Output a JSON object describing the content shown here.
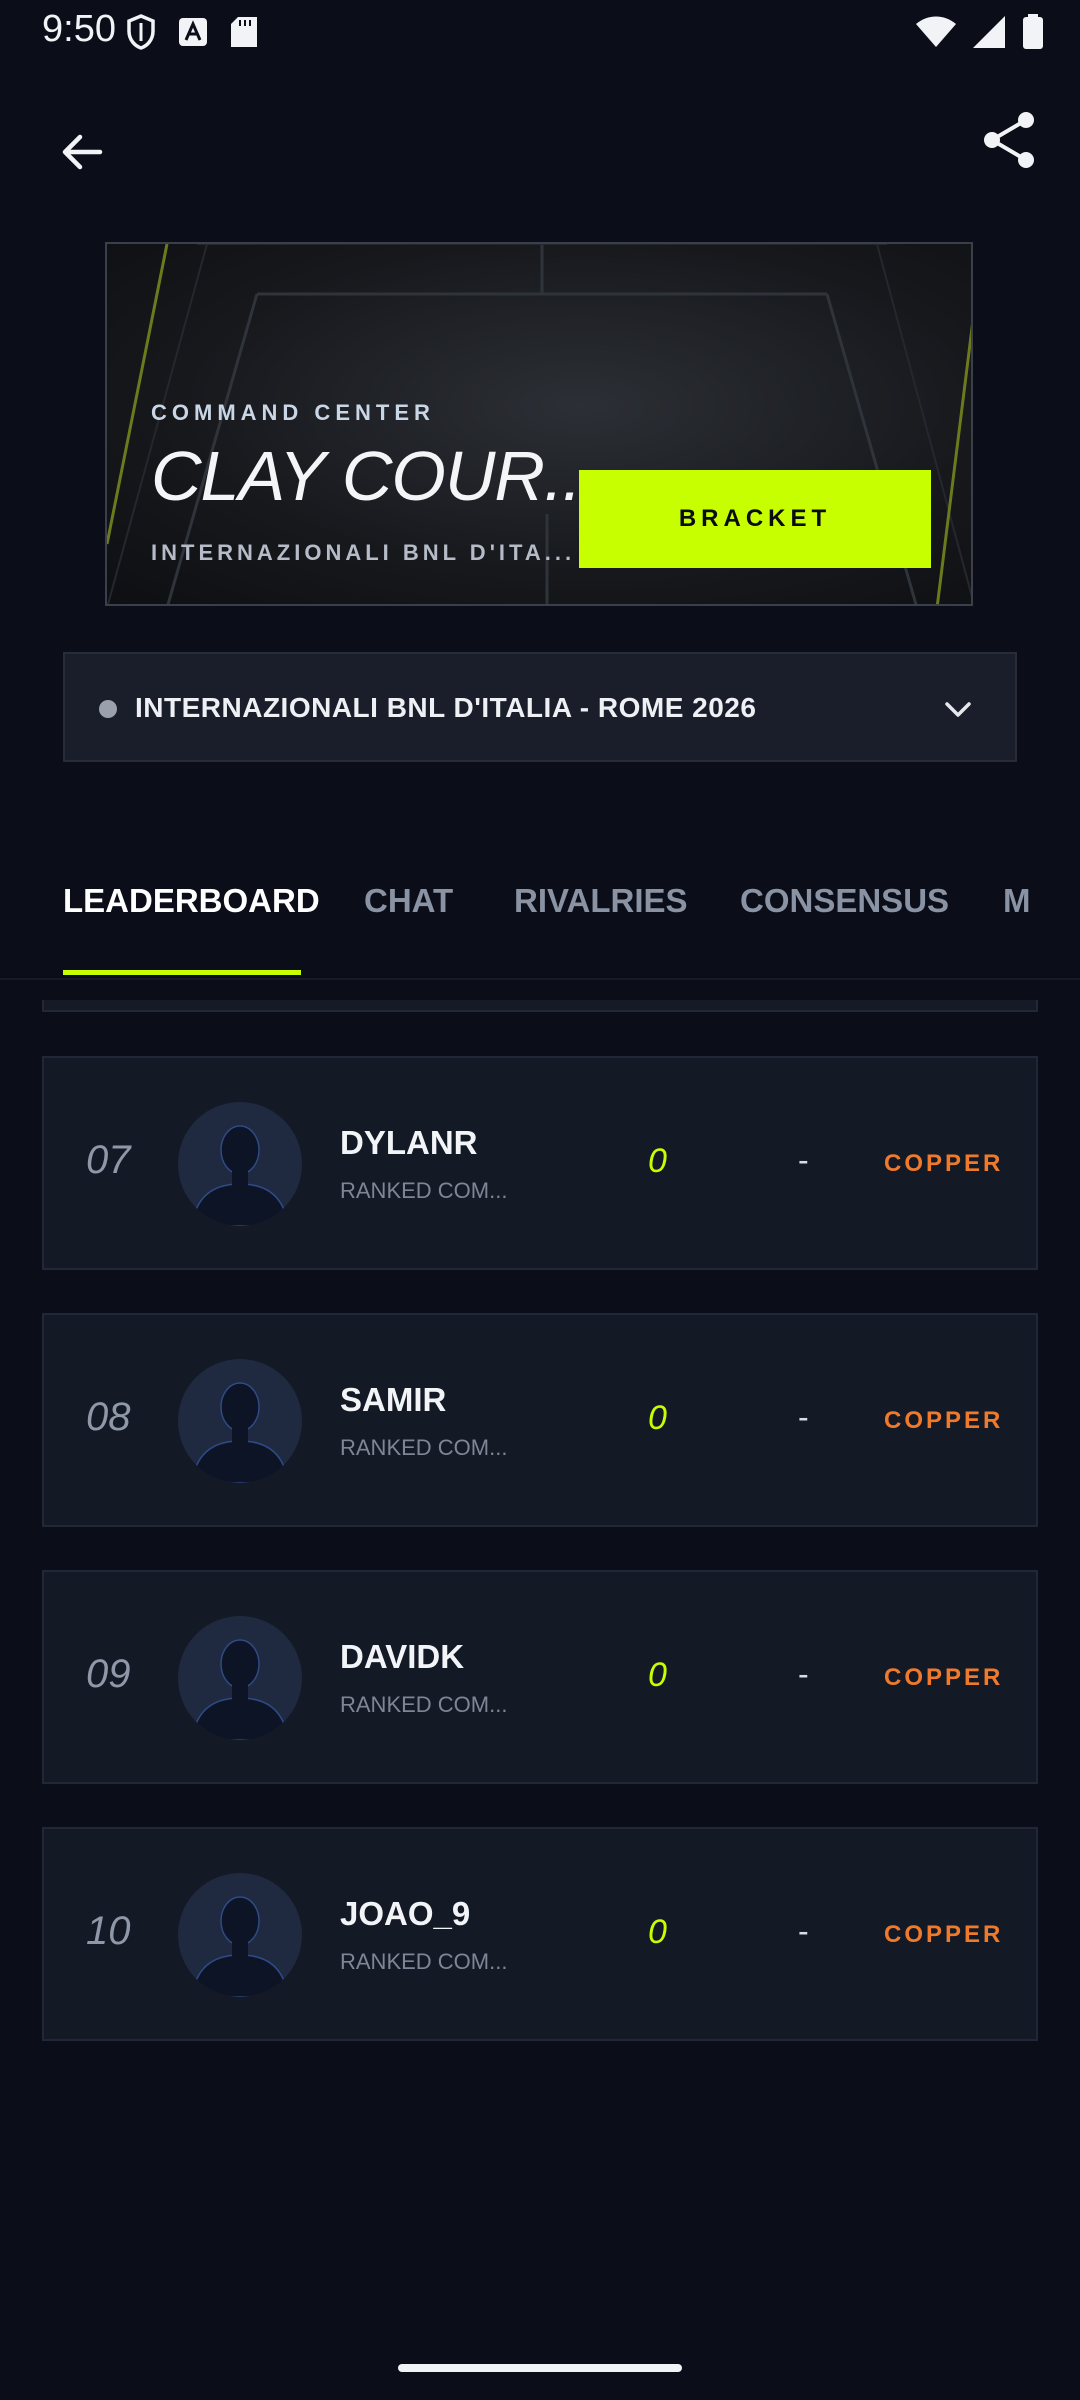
{
  "status_bar": {
    "time": "9:50"
  },
  "hero": {
    "eyebrow": "COMMAND CENTER",
    "title": "CLAY COUR...",
    "subtitle": "INTERNAZIONALI BNL D'ITA...",
    "bracket_label": "BRACKET"
  },
  "tournament_selector": {
    "label": "INTERNAZIONALI BNL D'ITALIA - ROME 2026"
  },
  "tabs": [
    {
      "label": "LEADERBOARD"
    },
    {
      "label": "CHAT"
    },
    {
      "label": "RIVALRIES"
    },
    {
      "label": "CONSENSUS"
    },
    {
      "label": "M"
    }
  ],
  "leaderboard": [
    {
      "rank": "07",
      "name": "DYLANR",
      "league": "RANKED COM...",
      "score": "0",
      "change": "-",
      "tier": "COPPER"
    },
    {
      "rank": "08",
      "name": "SAMIR",
      "league": "RANKED COM...",
      "score": "0",
      "change": "-",
      "tier": "COPPER"
    },
    {
      "rank": "09",
      "name": "DAVIDK",
      "league": "RANKED COM...",
      "score": "0",
      "change": "-",
      "tier": "COPPER"
    },
    {
      "rank": "10",
      "name": "JOAO_9",
      "league": "RANKED COM...",
      "score": "0",
      "change": "-",
      "tier": "COPPER"
    }
  ],
  "colors": {
    "accent": "#c8ff00",
    "tier_copper": "#ef7a2b",
    "background": "#0b0e18"
  }
}
